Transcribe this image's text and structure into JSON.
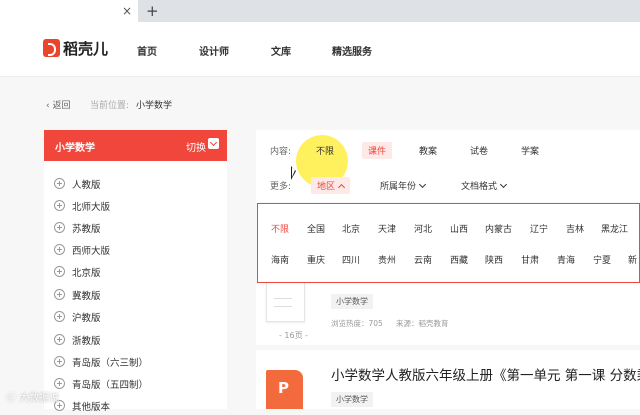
{
  "browser": {
    "tab_close": "×",
    "new_tab": "+"
  },
  "header": {
    "logo_text": "稻壳儿",
    "nav": [
      "首页",
      "设计师",
      "文库",
      "精选服务"
    ]
  },
  "breadcrumb": {
    "back": "返回",
    "label": "当前位置:",
    "value": "小学数学"
  },
  "sidebar": {
    "title": "小学数学",
    "switch": "切换",
    "items": [
      "人教版",
      "北师大版",
      "苏教版",
      "西师大版",
      "北京版",
      "冀教版",
      "沪教版",
      "浙教版",
      "青岛版（六三制）",
      "青岛版（五四制）",
      "其他版本"
    ]
  },
  "filters": {
    "content_label": "内容:",
    "content_options": [
      "不限",
      "课件",
      "教案",
      "试卷",
      "学案"
    ],
    "content_active": "课件",
    "more_label": "更多:",
    "more_active": "地区",
    "grade_dropdown": "所属年份",
    "format_dropdown": "文档格式"
  },
  "regions": {
    "row1": [
      "不限",
      "全国",
      "北京",
      "天津",
      "河北",
      "山西",
      "内蒙古",
      "辽宁",
      "吉林",
      "黑龙江"
    ],
    "row2": [
      "海南",
      "重庆",
      "四川",
      "贵州",
      "云南",
      "西藏",
      "陕西",
      "甘肃",
      "青海",
      "宁夏",
      "新"
    ]
  },
  "results": [
    {
      "tag": "小学数学",
      "views_label": "浏览热度：705",
      "source_label": "来源：稻壳教育",
      "pages": "- 16页 -"
    },
    {
      "title": "小学数学人教版六年级上册《第一单元 第一课 分数乘法",
      "tag": "小学数学"
    }
  ],
  "watermark": "ⓒ 大数据说"
}
